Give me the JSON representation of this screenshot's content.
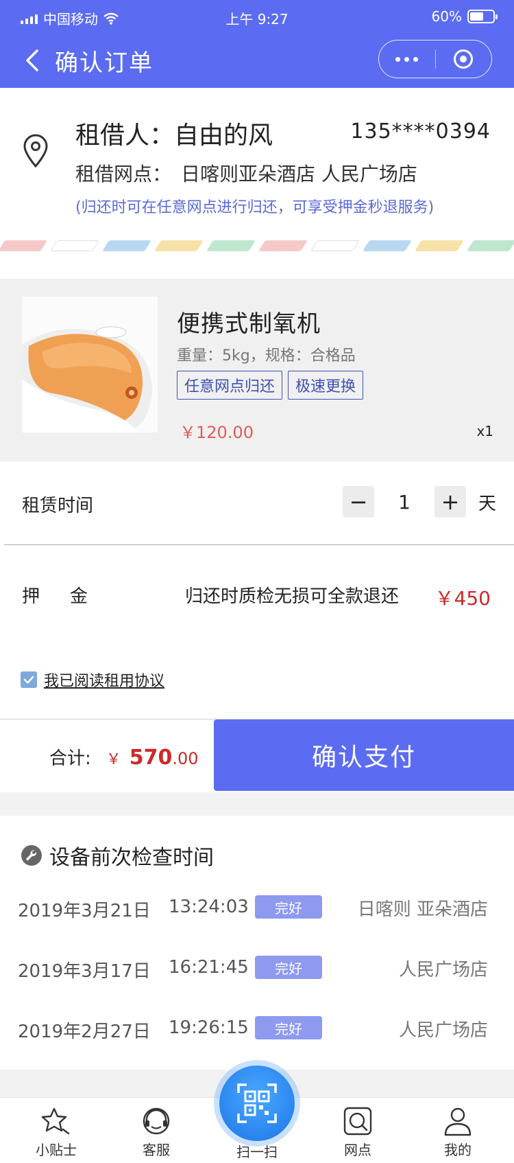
{
  "status_bar": {
    "carrier": "中国移动",
    "time": "上午 9:27",
    "battery": "60%",
    "battery_level": 0.6
  },
  "nav": {
    "title": "确认订单"
  },
  "renter": {
    "label": "租借人：",
    "name": "自由的风",
    "phone": "135****0394",
    "site_label": "租借网点：",
    "site_name": "日喀则亚朵酒店 人民广场店",
    "notice": "(归还时可在任意网点进行归还，可享受押金秒退服务)"
  },
  "product": {
    "name": "便携式制氧机",
    "spec": "重量：5kg，规格：合格品",
    "tags": [
      "任意网点归还",
      "极速更换"
    ],
    "price": "￥120.00",
    "quantity": "x1"
  },
  "rental_time": {
    "label": "租赁时间",
    "minus": "−",
    "value": "1",
    "plus": "+",
    "unit": "天"
  },
  "deposit": {
    "label": "押金",
    "note": "归还时质检无损可全款退还",
    "amount": "￥450"
  },
  "agreement": {
    "text": "我已阅读租用协议",
    "checked": true
  },
  "payment": {
    "total_label": "合计:",
    "currency": "￥",
    "amount_int": "570",
    "amount_dec": ".00",
    "button": "确认支付"
  },
  "inspection": {
    "title": "设备前次检查时间",
    "rows": [
      {
        "date": "2019年3月21日",
        "time": "13:24:03",
        "status": "完好",
        "location": "日喀则 亚朵酒店"
      },
      {
        "date": "2019年3月17日",
        "time": "16:21:45",
        "status": "完好",
        "location": "人民广场店"
      },
      {
        "date": "2019年2月27日",
        "time": "19:26:15",
        "status": "完好",
        "location": "人民广场店"
      }
    ]
  },
  "tabbar": {
    "tabs": [
      {
        "label": "小贴士",
        "icon": "star-icon"
      },
      {
        "label": "客服",
        "icon": "headset-icon"
      },
      {
        "label": "扫一扫",
        "icon": "qr-scan-icon"
      },
      {
        "label": "网点",
        "icon": "location-search-icon"
      },
      {
        "label": "我的",
        "icon": "user-icon"
      }
    ]
  },
  "colors": {
    "primary": "#5b6cf2",
    "price_red": "#cc2a2a",
    "tag_blue": "#3f50b5",
    "badge": "#8e99f0"
  }
}
